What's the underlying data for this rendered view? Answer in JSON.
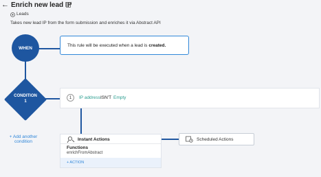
{
  "header": {
    "back_glyph": "←",
    "title": "Enrich new lead IP",
    "module": "Leads",
    "description": "Takes new lead IP from the form submission and enriches it via Abstract API"
  },
  "when": {
    "label": "WHEN",
    "text_prefix": "This rule will be executed when a lead is",
    "text_bold": "created."
  },
  "condition": {
    "label_line1": "CONDITION",
    "label_line2": "1",
    "number": "1",
    "field": "IP address",
    "operator": "ISN'T",
    "value": "Empty",
    "add_another_line1": "+ Add another",
    "add_another_line2": "condition"
  },
  "instant": {
    "title": "Instant Actions",
    "functions_label": "Functions",
    "function_name": "enrichFromAbstract",
    "add_action": "+ ACTION"
  },
  "scheduled": {
    "title": "Scheduled Actions"
  },
  "colors": {
    "primary": "#1e56a0",
    "link": "#2f86d8",
    "teal": "#2a9d8f"
  }
}
